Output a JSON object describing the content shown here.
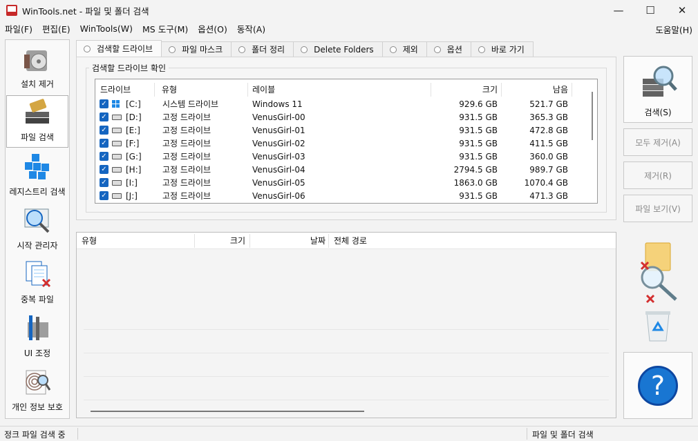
{
  "window": {
    "title": "WinTools.net - 파일 및 폴더 검색",
    "minimize": "—",
    "maximize": "☐",
    "close": "✕"
  },
  "menu": {
    "items": [
      "파일(F)",
      "편집(E)",
      "WinTools(W)",
      "MS 도구(M)",
      "옵션(O)",
      "동작(A)"
    ],
    "help": "도움말(H)"
  },
  "sidebar": {
    "items": [
      {
        "label": "설치 제거",
        "icon": "uninstall-icon"
      },
      {
        "label": "파일 검색",
        "icon": "file-search-icon",
        "active": true
      },
      {
        "label": "레지스트리 검색",
        "icon": "registry-search-icon"
      },
      {
        "label": "시작 관리자",
        "icon": "startup-manager-icon"
      },
      {
        "label": "중복 파일",
        "icon": "duplicate-files-icon"
      },
      {
        "label": "UI 조정",
        "icon": "ui-tweak-icon"
      },
      {
        "label": "개인 정보 보호",
        "icon": "privacy-icon"
      }
    ]
  },
  "tabs": [
    "검색할 드라이브",
    "파일 마스크",
    "폴더 정리",
    "Delete Folders",
    "제외",
    "옵션",
    "바로 가기"
  ],
  "drives_group": {
    "title": "검색할 드라이브 확인",
    "columns": [
      "드라이브",
      "유형",
      "레이블",
      "크기",
      "남음"
    ],
    "rows": [
      {
        "drive": "[C:]",
        "type": "시스템 드라이브",
        "label": "Windows 11",
        "size": "929.6 GB",
        "free": "521.7 GB"
      },
      {
        "drive": "[D:]",
        "type": "고정 드라이브",
        "label": "VenusGirl-00",
        "size": "931.5 GB",
        "free": "365.3 GB"
      },
      {
        "drive": "[E:]",
        "type": "고정 드라이브",
        "label": "VenusGirl-01",
        "size": "931.5 GB",
        "free": "472.8 GB"
      },
      {
        "drive": "[F:]",
        "type": "고정 드라이브",
        "label": "VenusGirl-02",
        "size": "931.5 GB",
        "free": "411.5 GB"
      },
      {
        "drive": "[G:]",
        "type": "고정 드라이브",
        "label": "VenusGirl-03",
        "size": "931.5 GB",
        "free": "360.0 GB"
      },
      {
        "drive": "[H:]",
        "type": "고정 드라이브",
        "label": "VenusGirl-04",
        "size": "2794.5 GB",
        "free": "989.7 GB"
      },
      {
        "drive": "[I:]",
        "type": "고정 드라이브",
        "label": "VenusGirl-05",
        "size": "1863.0 GB",
        "free": "1070.4 GB"
      },
      {
        "drive": "[J:]",
        "type": "고정 드라이브",
        "label": "VenusGirl-06",
        "size": "931.5 GB",
        "free": "471.3 GB"
      }
    ]
  },
  "results": {
    "columns": [
      "유형",
      "크기",
      "날짜",
      "전체 경로"
    ]
  },
  "actions": {
    "search": "검색(S)",
    "remove_all": "모두 제거(A)",
    "remove": "제거(R)",
    "view_file": "파일 보기(V)",
    "help_glyph": "?"
  },
  "status": {
    "left": "정크 파일 검색 중",
    "right": "파일 및 폴더 검색"
  },
  "colors": {
    "accent": "#1565c0",
    "help_button": "#1976d2"
  }
}
